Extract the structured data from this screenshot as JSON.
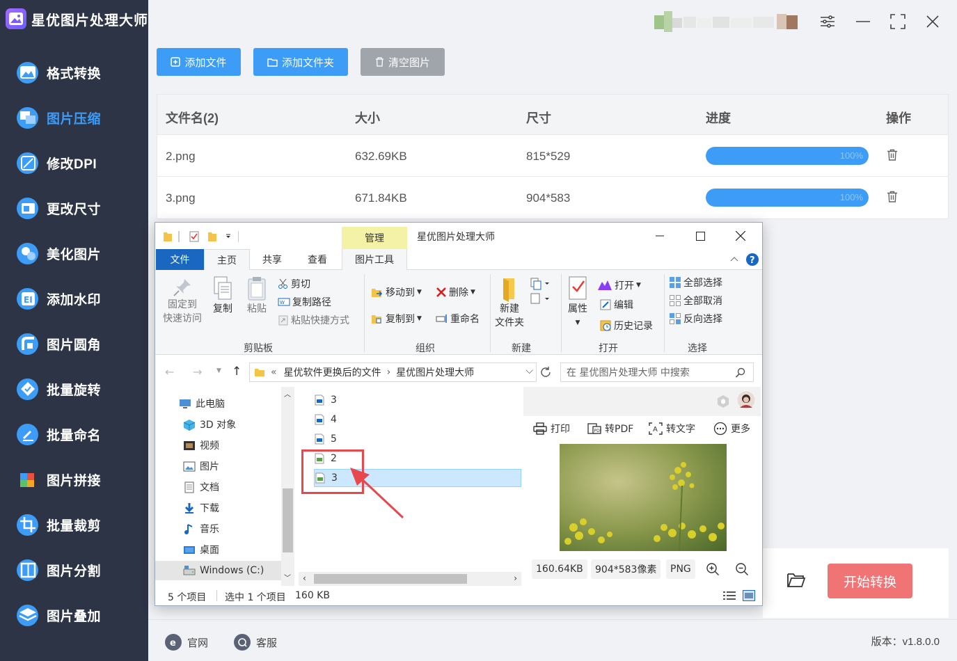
{
  "app": {
    "title": "星优图片处理大师",
    "version": "版本：v1.8.0.0"
  },
  "sidebar": {
    "items": [
      {
        "label": "格式转换",
        "icon": "image-format-icon",
        "color": "#3d9cf5"
      },
      {
        "label": "图片压缩",
        "icon": "compress-icon",
        "color": "#3d9cf5",
        "active": true
      },
      {
        "label": "修改DPI",
        "icon": "dpi-icon",
        "color": "#3d9cf5"
      },
      {
        "label": "更改尺寸",
        "icon": "resize-icon",
        "color": "#3d9cf5"
      },
      {
        "label": "美化图片",
        "icon": "beautify-icon",
        "color": "#3d9cf5"
      },
      {
        "label": "添加水印",
        "icon": "watermark-icon",
        "color": "#3d9cf5"
      },
      {
        "label": "图片圆角",
        "icon": "round-corner-icon",
        "color": "#3d9cf5"
      },
      {
        "label": "批量旋转",
        "icon": "rotate-icon",
        "color": "#3d9cf5"
      },
      {
        "label": "批量命名",
        "icon": "rename-icon",
        "color": "#3d9cf5"
      },
      {
        "label": "图片拼接",
        "icon": "puzzle-icon",
        "color": "#f5a623"
      },
      {
        "label": "批量裁剪",
        "icon": "crop-icon",
        "color": "#3d9cf5"
      },
      {
        "label": "图片分割",
        "icon": "split-icon",
        "color": "#3d9cf5"
      },
      {
        "label": "图片叠加",
        "icon": "layers-icon",
        "color": "#3d9cf5"
      }
    ]
  },
  "toolbar": {
    "add_file": "添加文件",
    "add_folder": "添加文件夹",
    "clear": "清空图片"
  },
  "table": {
    "headers": {
      "name": "文件名(2)",
      "size": "大小",
      "dims": "尺寸",
      "progress": "进度",
      "action": "操作"
    },
    "rows": [
      {
        "name": "2.png",
        "size": "632.69KB",
        "dims": "815*529",
        "progress_label": "100%",
        "progress": 1.0
      },
      {
        "name": "3.png",
        "size": "671.84KB",
        "dims": "904*583",
        "progress_label": "100%",
        "progress": 1.0
      }
    ]
  },
  "bottom": {
    "start_button": "开始转换"
  },
  "footer": {
    "website": "官网",
    "support": "客服"
  },
  "explorer": {
    "title": "星优图片处理大师",
    "manage_tab": "管理",
    "tabs": {
      "file": "文件",
      "home": "主页",
      "share": "共享",
      "view": "查看",
      "image_tools": "图片工具"
    },
    "ribbon": {
      "pin": "固定到\n快速访问",
      "pin_line1": "固定到",
      "pin_line2": "快速访问",
      "copy": "复制",
      "paste": "粘贴",
      "cut": "剪切",
      "copy_path": "复制路径",
      "paste_shortcut": "粘贴快捷方式",
      "clipboard": "剪贴板",
      "move_to": "移动到",
      "copy_to": "复制到",
      "delete": "删除",
      "rename": "重命名",
      "organize": "组织",
      "new_folder_line1": "新建",
      "new_folder_line2": "文件夹",
      "new": "新建",
      "properties": "属性",
      "open": "打开",
      "edit": "编辑",
      "history": "历史记录",
      "open_group": "打开",
      "select_all": "全部选择",
      "select_none": "全部取消",
      "invert_select": "反向选择",
      "select_group": "选择"
    },
    "address": {
      "prefix": "«",
      "crumb1": "星优软件更换后的文件",
      "crumb2": "星优图片处理大师",
      "search_placeholder": "在 星优图片处理大师 中搜索"
    },
    "tree": [
      {
        "label": "此电脑",
        "icon": "pc-icon"
      },
      {
        "label": "3D 对象",
        "icon": "cube-icon"
      },
      {
        "label": "视频",
        "icon": "video-icon"
      },
      {
        "label": "图片",
        "icon": "pictures-icon"
      },
      {
        "label": "文档",
        "icon": "document-icon"
      },
      {
        "label": "下载",
        "icon": "download-icon"
      },
      {
        "label": "音乐",
        "icon": "music-icon"
      },
      {
        "label": "桌面",
        "icon": "desktop-icon"
      },
      {
        "label": "Windows (C:)",
        "icon": "drive-icon"
      }
    ],
    "files": [
      {
        "name": "3",
        "type": "blue"
      },
      {
        "name": "4",
        "type": "blue"
      },
      {
        "name": "5",
        "type": "blue"
      },
      {
        "name": "2",
        "type": "green"
      },
      {
        "name": "3",
        "type": "green",
        "selected": true
      }
    ],
    "preview": {
      "print": "打印",
      "to_pdf": "转PDF",
      "to_text": "转文字",
      "more": "更多",
      "size": "160.64KB",
      "dims": "904*583像素",
      "format": "PNG"
    },
    "status": {
      "count": "5 个项目",
      "selected": "选中 1 个项目",
      "sel_size": "160 KB"
    }
  },
  "colors": {
    "sidebar_bg": "#2d3446",
    "accent": "#3d9cf5",
    "start_button": "#f17474",
    "clear_button": "#a0a4ab",
    "annotation": "#e5484d"
  }
}
